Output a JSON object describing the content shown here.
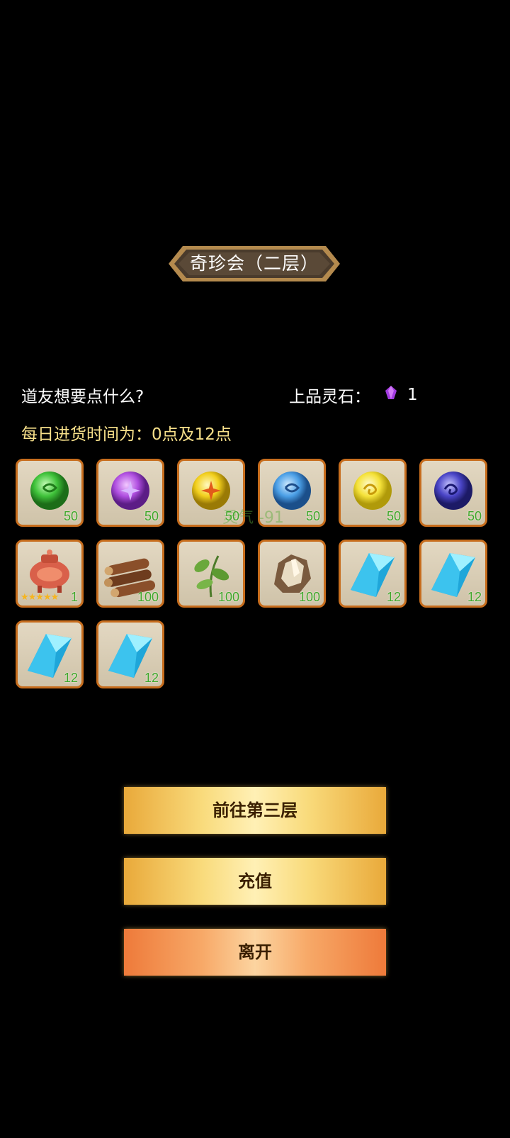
{
  "title": "奇珍会（二层）",
  "greeting": "道友想要点什么?",
  "currency": {
    "label": "上品灵石：",
    "value": "1",
    "icon": "purple-gem-icon",
    "color": "#a23be0"
  },
  "schedule": "每日进货时间为：0点及12点",
  "watermark": "灵气 -91",
  "items": [
    {
      "icon": "green-spirit-orb-icon",
      "qty": "50",
      "color": "#3fc23a"
    },
    {
      "icon": "purple-spirit-orb-icon",
      "qty": "50",
      "color": "#b04fe0"
    },
    {
      "icon": "yellow-spirit-orb-icon",
      "qty": "50",
      "color": "#f2cf1d"
    },
    {
      "icon": "blue-spirit-orb-icon",
      "qty": "50",
      "color": "#4b9fe6"
    },
    {
      "icon": "gold-swirl-orb-icon",
      "qty": "50",
      "color": "#f5e23a"
    },
    {
      "icon": "indigo-swirl-orb-icon",
      "qty": "50",
      "color": "#4a45c7"
    },
    {
      "icon": "red-incense-burner-icon",
      "qty": "1",
      "stars": "★★★★★"
    },
    {
      "icon": "wood-logs-icon",
      "qty": "100"
    },
    {
      "icon": "herb-leaf-icon",
      "qty": "100"
    },
    {
      "icon": "ore-rock-icon",
      "qty": "100"
    },
    {
      "icon": "blue-crystal-icon",
      "qty": "12"
    },
    {
      "icon": "blue-crystal-icon",
      "qty": "12"
    },
    {
      "icon": "blue-crystal-icon",
      "qty": "12"
    },
    {
      "icon": "blue-crystal-icon",
      "qty": "12"
    }
  ],
  "buttons": {
    "next_floor": "前往第三层",
    "recharge": "充值",
    "leave": "离开"
  }
}
